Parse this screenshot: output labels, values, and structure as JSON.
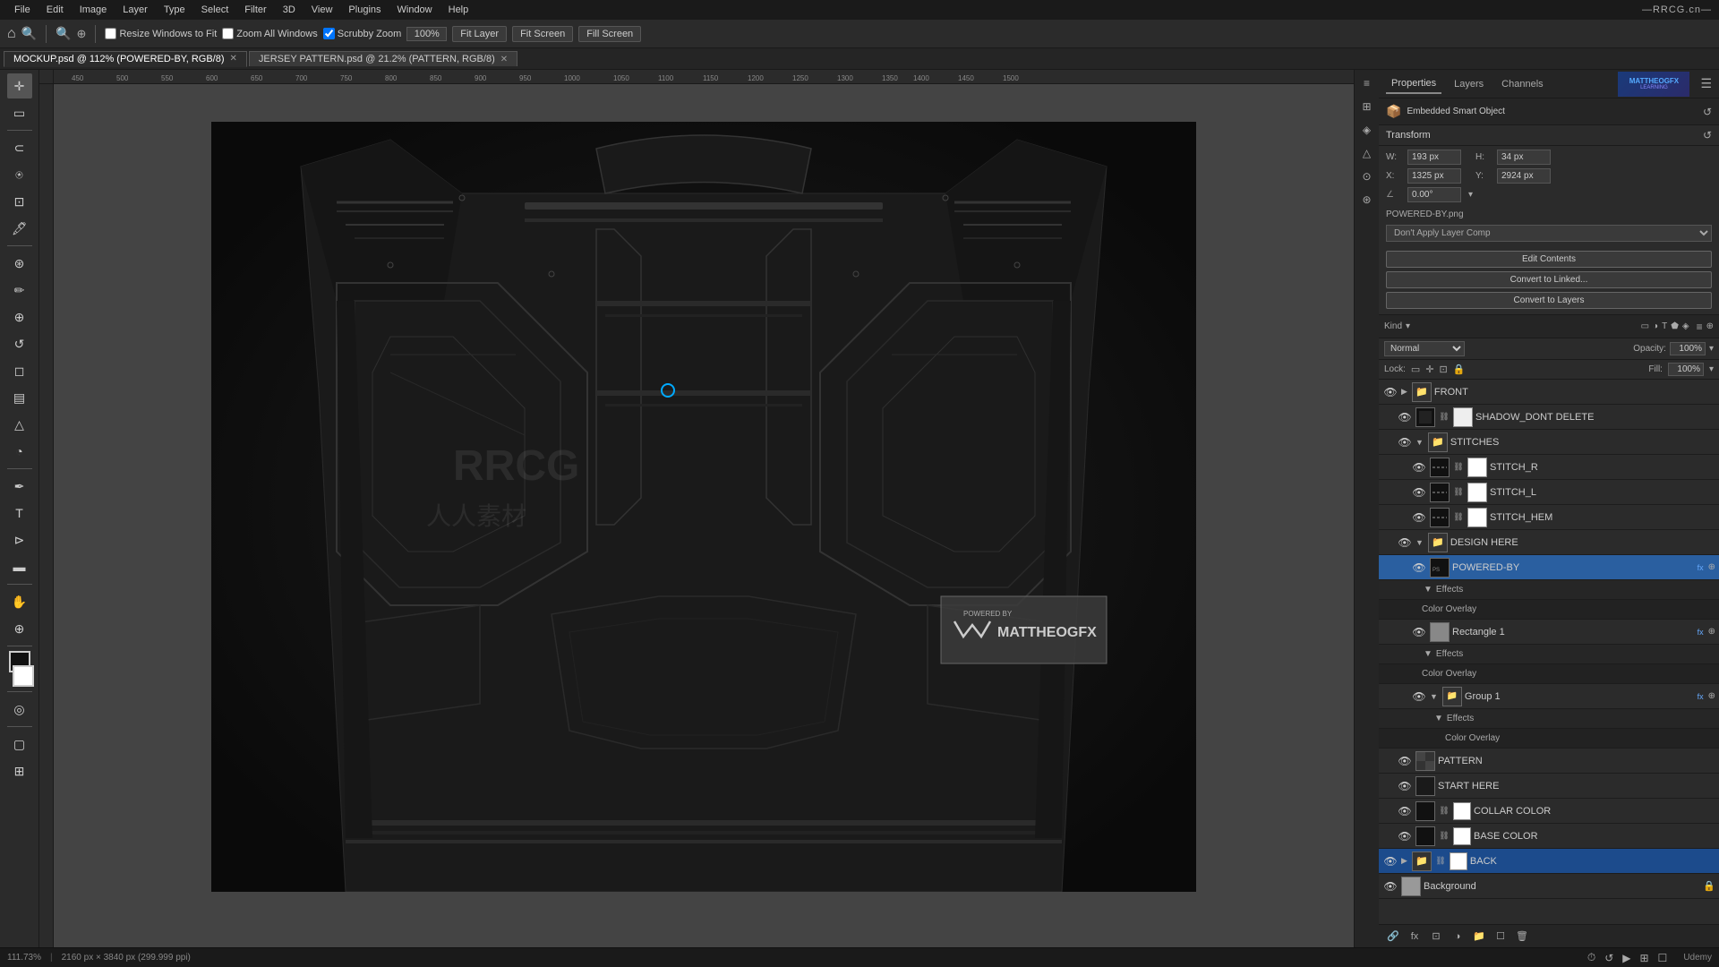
{
  "app": {
    "title": "—RRCG.cn—",
    "menu": [
      "File",
      "Edit",
      "Image",
      "Layer",
      "Type",
      "Select",
      "Filter",
      "3D",
      "View",
      "Plugins",
      "Window",
      "Help"
    ]
  },
  "toolbar": {
    "resize_windows": "Resize Windows to Fit",
    "zoom_all": "Zoom All Windows",
    "scrubby_zoom": "Scrubby Zoom",
    "zoom_level": "100%",
    "fit_layer": "Fit Layer",
    "fit_screen": "Fit Screen",
    "fill_screen": "Fill Screen"
  },
  "tabs": [
    {
      "label": "MOCKUP.psd @ 112% (POWERED-BY, RGB/8)",
      "active": true,
      "modified": true
    },
    {
      "label": "JERSEY PATTERN.psd @ 21.2% (PATTERN, RGB/8)",
      "active": false,
      "modified": false
    }
  ],
  "properties": {
    "title": "Properties",
    "transform_label": "Transform",
    "W_label": "W:",
    "W_value": "193 px",
    "H_label": "H:",
    "H_value": "34 px",
    "X_label": "X:",
    "X_value": "1325 px",
    "Y_label": "Y:",
    "Y_value": "2924 px",
    "angle_value": "0.00°",
    "smart_object_label": "Embedded Smart Object",
    "file_name": "POWERED-BY.png",
    "layer_comp": "Don't Apply Layer Comp",
    "btn_edit": "Edit Contents",
    "btn_convert_linked": "Convert to Linked...",
    "btn_convert_layers": "Convert to Layers"
  },
  "layers_panel": {
    "title": "Layers",
    "channels_tab": "Channels",
    "properties_tab": "Properties",
    "search_placeholder": "Kind",
    "blend_mode": "Normal",
    "opacity_label": "Opacity:",
    "opacity_value": "100%",
    "fill_label": "Fill:",
    "fill_value": "100%",
    "layers": [
      {
        "id": "front",
        "name": "FRONT",
        "type": "group",
        "visible": true,
        "indent": 0,
        "collapsed": true
      },
      {
        "id": "shadow_dont_delete",
        "name": "SHADOW_DONT DELETE",
        "type": "layer",
        "visible": true,
        "indent": 1
      },
      {
        "id": "stitches",
        "name": "STITCHES",
        "type": "group",
        "visible": true,
        "indent": 1,
        "collapsed": false
      },
      {
        "id": "stitch_r",
        "name": "STITCH_R",
        "type": "layer",
        "visible": true,
        "indent": 2
      },
      {
        "id": "stitch_l",
        "name": "STITCH_L",
        "type": "layer",
        "visible": true,
        "indent": 2
      },
      {
        "id": "stitch_hem",
        "name": "STITCH_HEM",
        "type": "layer",
        "visible": true,
        "indent": 2
      },
      {
        "id": "design_here",
        "name": "DESIGN HERE",
        "type": "group",
        "visible": true,
        "indent": 1,
        "collapsed": false
      },
      {
        "id": "powered_by",
        "name": "POWERED-BY",
        "type": "smart",
        "visible": true,
        "indent": 2,
        "fx": true,
        "active": true
      },
      {
        "id": "effects_powered",
        "name": "Effects",
        "type": "effects",
        "visible": true,
        "indent": 2
      },
      {
        "id": "color_overlay_powered",
        "name": "Color Overlay",
        "type": "effect-item",
        "visible": true,
        "indent": 2
      },
      {
        "id": "rect1",
        "name": "Rectangle 1",
        "type": "shape",
        "visible": true,
        "indent": 2,
        "fx": true
      },
      {
        "id": "effects_rect1",
        "name": "Effects",
        "type": "effects",
        "visible": true,
        "indent": 2
      },
      {
        "id": "color_overlay_rect1",
        "name": "Color Overlay",
        "type": "effect-item",
        "visible": true,
        "indent": 2
      },
      {
        "id": "group1",
        "name": "Group 1",
        "type": "group",
        "visible": true,
        "indent": 2,
        "fx": true,
        "collapsed": false
      },
      {
        "id": "effects_group1",
        "name": "Effects",
        "type": "effects",
        "visible": true,
        "indent": 3
      },
      {
        "id": "color_overlay_group1",
        "name": "Color Overlay",
        "type": "effect-item",
        "visible": true,
        "indent": 3
      },
      {
        "id": "pattern",
        "name": "PATTERN",
        "type": "smart",
        "visible": true,
        "indent": 1
      },
      {
        "id": "start_here",
        "name": "START HERE",
        "type": "layer",
        "visible": true,
        "indent": 1
      },
      {
        "id": "collar_color",
        "name": "COLLAR COLOR",
        "type": "layer",
        "visible": true,
        "indent": 1
      },
      {
        "id": "base_color",
        "name": "BASE COLOR",
        "type": "layer",
        "visible": true,
        "indent": 1
      },
      {
        "id": "back",
        "name": "BACK",
        "type": "group",
        "visible": true,
        "indent": 0,
        "collapsed": true,
        "selected": true
      },
      {
        "id": "background",
        "name": "Background",
        "type": "layer",
        "visible": true,
        "indent": 0,
        "locked": true
      }
    ]
  },
  "statusbar": {
    "zoom": "111.73%",
    "dimensions": "2160 px × 3840 px (299.999 ppi)"
  },
  "brand": {
    "name": "MATTHEOGFX",
    "sub": "LEARNING"
  },
  "watermark": {
    "line1": "RRCG",
    "line2": "人人素材"
  },
  "canvas": {
    "zoom": "112%",
    "canvas_bg": "#111111"
  }
}
